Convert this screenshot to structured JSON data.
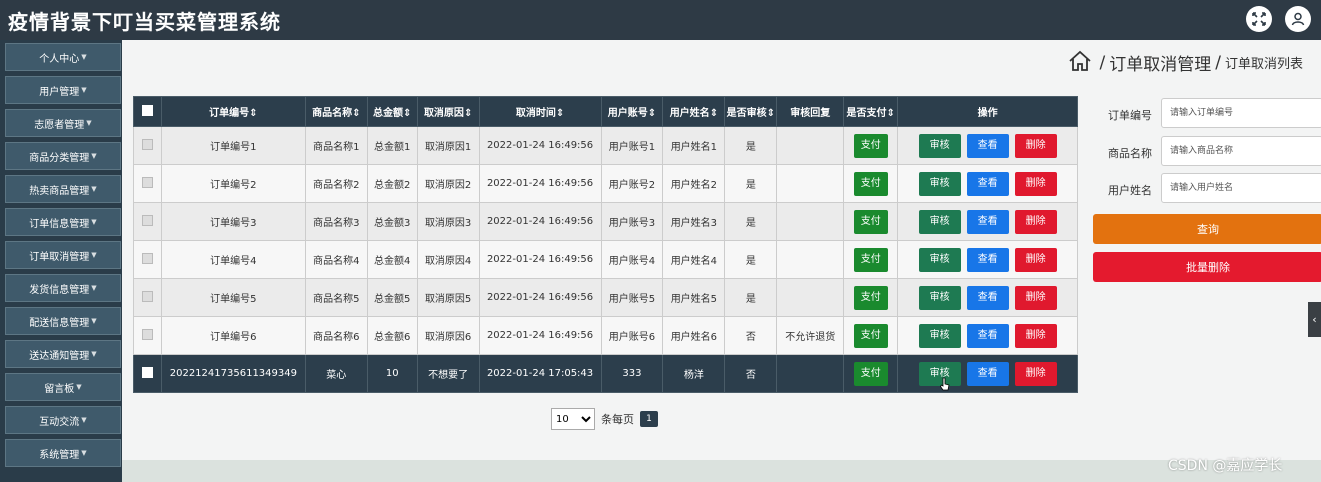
{
  "app": {
    "title": "疫情背景下叮当买菜管理系统"
  },
  "header": {
    "fullscreen_icon": "expand-icon",
    "user_icon": "user-icon"
  },
  "sidebar": {
    "items": [
      {
        "label": "个人中心"
      },
      {
        "label": "用户管理"
      },
      {
        "label": "志愿者管理"
      },
      {
        "label": "商品分类管理"
      },
      {
        "label": "热卖商品管理"
      },
      {
        "label": "订单信息管理"
      },
      {
        "label": "订单取消管理"
      },
      {
        "label": "发货信息管理"
      },
      {
        "label": "配送信息管理"
      },
      {
        "label": "送达通知管理"
      },
      {
        "label": "留言板"
      },
      {
        "label": "互动交流"
      },
      {
        "label": "系统管理"
      }
    ]
  },
  "breadcrumb": {
    "home_icon": "home-icon",
    "sep1": "/",
    "main": "订单取消管理",
    "sep2": "/",
    "sub": "订单取消列表"
  },
  "table": {
    "headers": [
      "订单编号",
      "商品名称",
      "总金额",
      "取消原因",
      "取消时间",
      "用户账号",
      "用户姓名",
      "是否审核",
      "审核回复",
      "是否支付",
      "操作"
    ],
    "rows": [
      {
        "order_no": "订单编号1",
        "product": "商品名称1",
        "amount": "总金额1",
        "reason": "取消原因1",
        "time": "2022-01-24 16:49:56",
        "account": "用户账号1",
        "name": "用户姓名1",
        "audited": "是",
        "reply": ""
      },
      {
        "order_no": "订单编号2",
        "product": "商品名称2",
        "amount": "总金额2",
        "reason": "取消原因2",
        "time": "2022-01-24 16:49:56",
        "account": "用户账号2",
        "name": "用户姓名2",
        "audited": "是",
        "reply": ""
      },
      {
        "order_no": "订单编号3",
        "product": "商品名称3",
        "amount": "总金额3",
        "reason": "取消原因3",
        "time": "2022-01-24 16:49:56",
        "account": "用户账号3",
        "name": "用户姓名3",
        "audited": "是",
        "reply": ""
      },
      {
        "order_no": "订单编号4",
        "product": "商品名称4",
        "amount": "总金额4",
        "reason": "取消原因4",
        "time": "2022-01-24 16:49:56",
        "account": "用户账号4",
        "name": "用户姓名4",
        "audited": "是",
        "reply": ""
      },
      {
        "order_no": "订单编号5",
        "product": "商品名称5",
        "amount": "总金额5",
        "reason": "取消原因5",
        "time": "2022-01-24 16:49:56",
        "account": "用户账号5",
        "name": "用户姓名5",
        "audited": "是",
        "reply": ""
      },
      {
        "order_no": "订单编号6",
        "product": "商品名称6",
        "amount": "总金额6",
        "reason": "取消原因6",
        "time": "2022-01-24 16:49:56",
        "account": "用户账号6",
        "name": "用户姓名6",
        "audited": "否",
        "reply": "不允许退货"
      },
      {
        "order_no": "20221241735611349349",
        "product": "菜心",
        "amount": "10",
        "reason": "不想要了",
        "time": "2022-01-24 17:05:43",
        "account": "333",
        "name": "杨洋",
        "audited": "否",
        "reply": ""
      }
    ],
    "buttons": {
      "pay": "支付",
      "audit": "审核",
      "view": "查看",
      "delete": "删除"
    }
  },
  "pagination": {
    "page_size": "10",
    "page_size_options": [
      "10"
    ],
    "per_page_label": "条每页",
    "current_page": "1"
  },
  "search": {
    "order_no_label": "订单编号",
    "order_no_placeholder": "请输入订单编号",
    "product_label": "商品名称",
    "product_placeholder": "请输入商品名称",
    "name_label": "用户姓名",
    "name_placeholder": "请输入用户姓名",
    "query_button": "查询",
    "batch_delete_button": "批量删除"
  },
  "colors": {
    "topbar": "#2e3a45",
    "sidebar": "#2a3c49",
    "query": "#e3720f",
    "batch_delete": "#e41a2e",
    "pay": "#1a8a2e",
    "audit": "#1e7a52",
    "view": "#1876e8",
    "delete": "#e0192e"
  },
  "watermark": "CSDN @嘉应学长"
}
